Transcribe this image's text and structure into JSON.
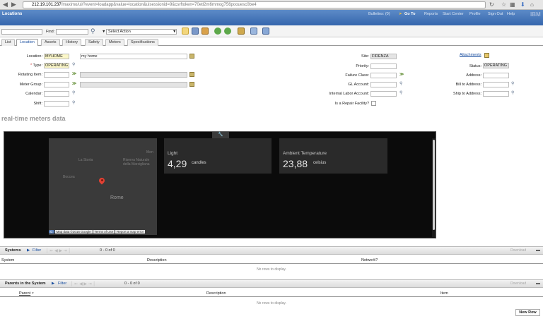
{
  "browser": {
    "url_host": "212.19.101.237",
    "url_rest": "/maximo/ui/?event=loadapp&value=location&uisessionid=9&csrftoken=70etl2m6mmog756poouesc0be4"
  },
  "app": {
    "title": "Locations",
    "links": [
      "Bulletins: (0)",
      "Go To",
      "Reports",
      "Start Center",
      "Profile",
      "Sign Out",
      "Help"
    ],
    "logo": "IBM"
  },
  "toolbar": {
    "find_label": "Find:",
    "find_value": "",
    "action_value": "Select Action"
  },
  "tabs": [
    "List",
    "Location",
    "Assets",
    "History",
    "Safety",
    "Meters",
    "Specifications"
  ],
  "active_tab": "Location",
  "left_fields": {
    "location_label": "Location:",
    "location_value": "MYHOME",
    "location_desc": "my home",
    "type_label": "Type:",
    "type_value": "OPERATING",
    "rotating_label": "Rotating Item:",
    "meter_group_label": "Meter Group:",
    "calendar_label": "Calendar:",
    "shift_label": "Shift:"
  },
  "mid_fields": {
    "site_label": "Site:",
    "site_value": "FIDENZA",
    "priority_label": "Priority:",
    "failure_label": "Failure Class:",
    "gl_label": "GL Account:",
    "labor_label": "Internal Labor Account:",
    "repair_label": "Is a Repair Facility?"
  },
  "right_fields": {
    "attachments_label": "Attachments",
    "status_label": "Status:",
    "status_value": "OPERATING",
    "address_label": "Address:",
    "bill_label": "Bill to Address:",
    "ship_label": "Ship to Address:"
  },
  "realtime": {
    "title": "real-time meters data",
    "map_labels": {
      "city": "Rome",
      "l1": "La Storta",
      "l2": "Riserva Naturale della Marcigliana",
      "l3": "Boccea",
      "l4": "Men"
    },
    "map_footer": [
      "Map data ©2016 Google",
      "Terms of Use",
      "Report a map error"
    ],
    "cards": [
      {
        "title": "Light",
        "value": "4,29",
        "unit": "candles"
      },
      {
        "title": "Ambient Temperature",
        "value": "23,88",
        "unit": "celsius"
      }
    ]
  },
  "systems": {
    "title": "Systems",
    "filter": "Filter",
    "count": "0 - 0 of 0",
    "download": "Download",
    "columns": [
      "System",
      "Description",
      "Network?"
    ],
    "empty": "No rows to display."
  },
  "parents": {
    "title": "Parents in the System",
    "filter": "Filter",
    "count": "0 - 0 of 0",
    "download": "Download",
    "columns": [
      "Parent",
      "Description",
      "Item"
    ],
    "empty": "No rows to display.",
    "new_row": "New Row"
  }
}
